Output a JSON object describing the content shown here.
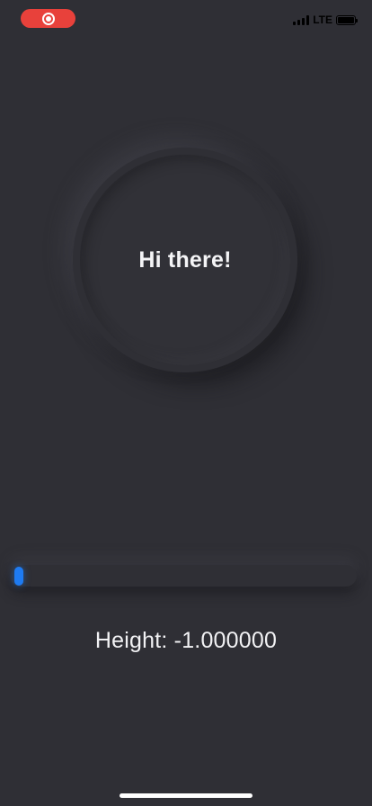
{
  "status_bar": {
    "recording_icon": "screen-recording-icon",
    "recording_color": "#e8413b",
    "network": "LTE",
    "signal_icon": "cellular-signal-icon",
    "battery_icon": "battery-icon",
    "battery_level": 1.0
  },
  "circle": {
    "greeting": "Hi there!"
  },
  "slider": {
    "value_fraction": 0.0,
    "thumb_color": "#1e7bf2"
  },
  "readout": {
    "height_text": "Height: -1.000000"
  },
  "colors": {
    "background": "#2f2f35",
    "text": "#f2f2f4",
    "accent": "#1e7bf2"
  }
}
